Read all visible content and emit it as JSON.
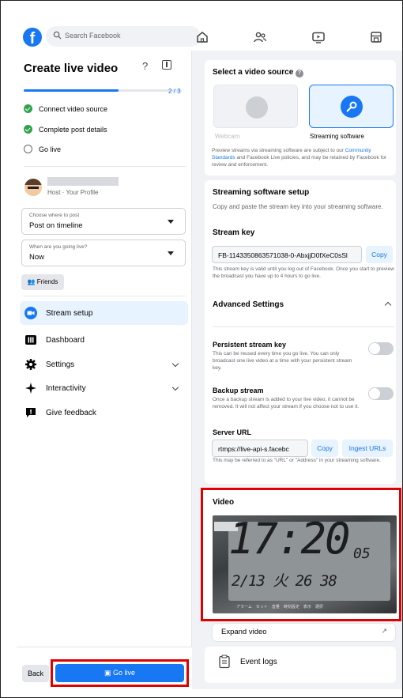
{
  "nav": {
    "search_placeholder": "Search Facebook",
    "logo": "f",
    "icons": [
      "home-icon",
      "friends-icon",
      "watch-icon",
      "marketplace-icon"
    ]
  },
  "left": {
    "title": "Create live video",
    "progress": {
      "text": "2 / 3",
      "fraction": 0.6
    },
    "steps": [
      {
        "label": "Connect video source",
        "done": true
      },
      {
        "label": "Complete post details",
        "done": true
      },
      {
        "label": "Go live",
        "done": false
      }
    ],
    "host_label": "Host · Your Profile",
    "post_dropdown": {
      "small": "Choose where to post",
      "value": "Post on timeline"
    },
    "when_dropdown": {
      "small": "When are you going live?",
      "value": "Now"
    },
    "audience": "Friends",
    "menu": [
      {
        "label": "Stream setup"
      },
      {
        "label": "Dashboard"
      },
      {
        "label": "Settings"
      },
      {
        "label": "Interactivity"
      },
      {
        "label": "Give feedback"
      }
    ],
    "back_label": "Back",
    "golive_label": "Go live"
  },
  "right": {
    "source": {
      "title": "Select a video source",
      "webcam": "Webcam",
      "streaming": "Streaming software",
      "note_a": "Preview streams via streaming software are subject to our ",
      "note_link": "Community Standards",
      "note_b": " and Facebook Live policies, and may be retained by Facebook for review and enforcement."
    },
    "setup": {
      "title": "Streaming software setup",
      "desc": "Copy and paste the stream key into your streaming software.",
      "key_label": "Stream key",
      "key_value": "FB-1143350863571038-0-AbxjjD0fXeC0sSl",
      "copy": "Copy",
      "key_note": "This stream key is valid until you log out of Facebook. Once you start to preview the broadcast you have up to 4 hours to go live.",
      "advanced": "Advanced Settings",
      "persistent_title": "Persistent stream key",
      "persistent_desc": "This can be reused every time you go live. You can only broadcast one live video at a time with your persistent stream key.",
      "backup_title": "Backup stream",
      "backup_desc": "Once a backup stream is added to your live video, it cannot be removed. It will not affect your stream if you choose not to use it.",
      "server_label": "Server URL",
      "server_value": "rtmps://live-api-s.facebc",
      "copy2": "Copy",
      "ingest": "Ingest URLs",
      "server_note": "This may be referred to as \"URL\" or \"Address\" in your streaming software."
    },
    "video": {
      "title": "Video",
      "time": "17:20",
      "seconds": "05",
      "date_line": "2/13 火 26 38",
      "labels": "アラーム　セット　音量　時刻設定　表示　選択",
      "expand": "Expand video",
      "event_logs": "Event logs"
    }
  },
  "colors": {
    "accent": "#1877f2",
    "success": "#31a24c",
    "highlight": "#e00000"
  }
}
